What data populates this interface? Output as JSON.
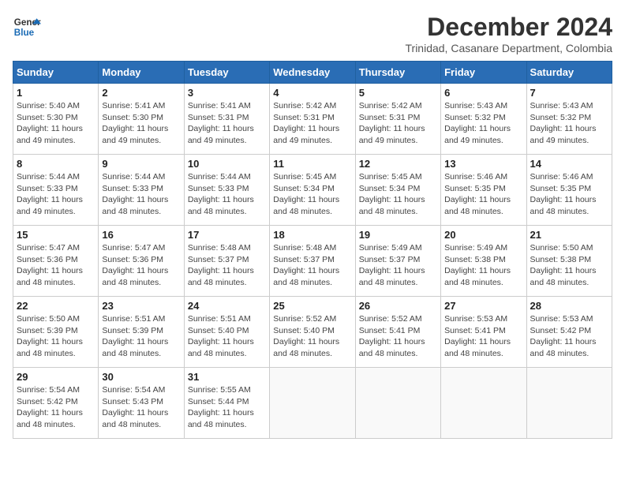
{
  "logo": {
    "line1": "General",
    "line2": "Blue"
  },
  "title": "December 2024",
  "location": "Trinidad, Casanare Department, Colombia",
  "weekdays": [
    "Sunday",
    "Monday",
    "Tuesday",
    "Wednesday",
    "Thursday",
    "Friday",
    "Saturday"
  ],
  "weeks": [
    [
      {
        "day": 1,
        "sunrise": "5:40 AM",
        "sunset": "5:30 PM",
        "daylight": "11 hours and 49 minutes."
      },
      {
        "day": 2,
        "sunrise": "5:41 AM",
        "sunset": "5:30 PM",
        "daylight": "11 hours and 49 minutes."
      },
      {
        "day": 3,
        "sunrise": "5:41 AM",
        "sunset": "5:31 PM",
        "daylight": "11 hours and 49 minutes."
      },
      {
        "day": 4,
        "sunrise": "5:42 AM",
        "sunset": "5:31 PM",
        "daylight": "11 hours and 49 minutes."
      },
      {
        "day": 5,
        "sunrise": "5:42 AM",
        "sunset": "5:31 PM",
        "daylight": "11 hours and 49 minutes."
      },
      {
        "day": 6,
        "sunrise": "5:43 AM",
        "sunset": "5:32 PM",
        "daylight": "11 hours and 49 minutes."
      },
      {
        "day": 7,
        "sunrise": "5:43 AM",
        "sunset": "5:32 PM",
        "daylight": "11 hours and 49 minutes."
      }
    ],
    [
      {
        "day": 8,
        "sunrise": "5:44 AM",
        "sunset": "5:33 PM",
        "daylight": "11 hours and 49 minutes."
      },
      {
        "day": 9,
        "sunrise": "5:44 AM",
        "sunset": "5:33 PM",
        "daylight": "11 hours and 48 minutes."
      },
      {
        "day": 10,
        "sunrise": "5:44 AM",
        "sunset": "5:33 PM",
        "daylight": "11 hours and 48 minutes."
      },
      {
        "day": 11,
        "sunrise": "5:45 AM",
        "sunset": "5:34 PM",
        "daylight": "11 hours and 48 minutes."
      },
      {
        "day": 12,
        "sunrise": "5:45 AM",
        "sunset": "5:34 PM",
        "daylight": "11 hours and 48 minutes."
      },
      {
        "day": 13,
        "sunrise": "5:46 AM",
        "sunset": "5:35 PM",
        "daylight": "11 hours and 48 minutes."
      },
      {
        "day": 14,
        "sunrise": "5:46 AM",
        "sunset": "5:35 PM",
        "daylight": "11 hours and 48 minutes."
      }
    ],
    [
      {
        "day": 15,
        "sunrise": "5:47 AM",
        "sunset": "5:36 PM",
        "daylight": "11 hours and 48 minutes."
      },
      {
        "day": 16,
        "sunrise": "5:47 AM",
        "sunset": "5:36 PM",
        "daylight": "11 hours and 48 minutes."
      },
      {
        "day": 17,
        "sunrise": "5:48 AM",
        "sunset": "5:37 PM",
        "daylight": "11 hours and 48 minutes."
      },
      {
        "day": 18,
        "sunrise": "5:48 AM",
        "sunset": "5:37 PM",
        "daylight": "11 hours and 48 minutes."
      },
      {
        "day": 19,
        "sunrise": "5:49 AM",
        "sunset": "5:37 PM",
        "daylight": "11 hours and 48 minutes."
      },
      {
        "day": 20,
        "sunrise": "5:49 AM",
        "sunset": "5:38 PM",
        "daylight": "11 hours and 48 minutes."
      },
      {
        "day": 21,
        "sunrise": "5:50 AM",
        "sunset": "5:38 PM",
        "daylight": "11 hours and 48 minutes."
      }
    ],
    [
      {
        "day": 22,
        "sunrise": "5:50 AM",
        "sunset": "5:39 PM",
        "daylight": "11 hours and 48 minutes."
      },
      {
        "day": 23,
        "sunrise": "5:51 AM",
        "sunset": "5:39 PM",
        "daylight": "11 hours and 48 minutes."
      },
      {
        "day": 24,
        "sunrise": "5:51 AM",
        "sunset": "5:40 PM",
        "daylight": "11 hours and 48 minutes."
      },
      {
        "day": 25,
        "sunrise": "5:52 AM",
        "sunset": "5:40 PM",
        "daylight": "11 hours and 48 minutes."
      },
      {
        "day": 26,
        "sunrise": "5:52 AM",
        "sunset": "5:41 PM",
        "daylight": "11 hours and 48 minutes."
      },
      {
        "day": 27,
        "sunrise": "5:53 AM",
        "sunset": "5:41 PM",
        "daylight": "11 hours and 48 minutes."
      },
      {
        "day": 28,
        "sunrise": "5:53 AM",
        "sunset": "5:42 PM",
        "daylight": "11 hours and 48 minutes."
      }
    ],
    [
      {
        "day": 29,
        "sunrise": "5:54 AM",
        "sunset": "5:42 PM",
        "daylight": "11 hours and 48 minutes."
      },
      {
        "day": 30,
        "sunrise": "5:54 AM",
        "sunset": "5:43 PM",
        "daylight": "11 hours and 48 minutes."
      },
      {
        "day": 31,
        "sunrise": "5:55 AM",
        "sunset": "5:44 PM",
        "daylight": "11 hours and 48 minutes."
      },
      null,
      null,
      null,
      null
    ]
  ]
}
